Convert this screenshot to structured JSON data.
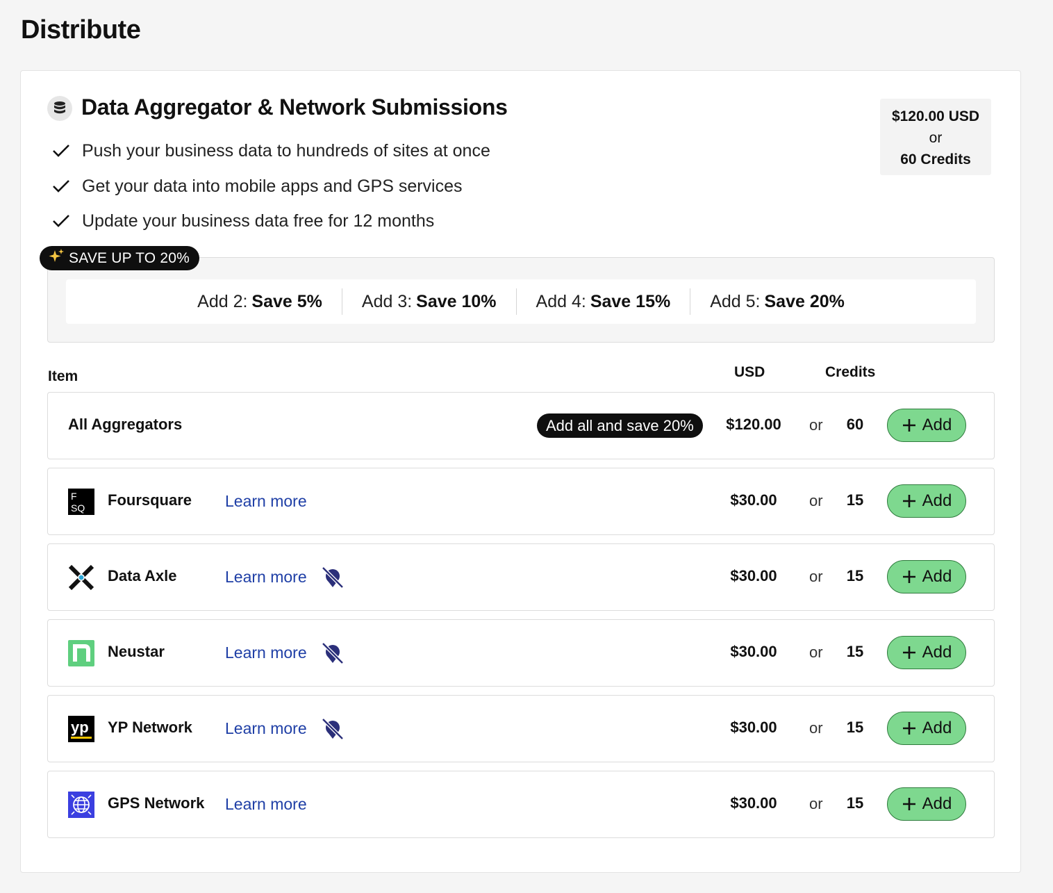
{
  "page": {
    "title": "Distribute"
  },
  "section": {
    "title": "Data Aggregator & Network Submissions",
    "price": {
      "usd": "$120.00 USD",
      "or": "or",
      "credits": "60 Credits"
    },
    "features": [
      "Push your business data to hundreds of sites at once",
      "Get your data into mobile apps and GPS services",
      "Update your business data free for 12 months"
    ]
  },
  "savings": {
    "badge": "SAVE UP TO 20%",
    "tiers": [
      {
        "label": "Add 2:",
        "value": "Save 5%"
      },
      {
        "label": "Add 3:",
        "value": "Save 10%"
      },
      {
        "label": "Add 4:",
        "value": "Save 15%"
      },
      {
        "label": "Add 5:",
        "value": "Save 20%"
      }
    ]
  },
  "table": {
    "headers": {
      "item": "Item",
      "usd": "USD",
      "credits": "Credits"
    },
    "all": {
      "name": "All Aggregators",
      "pill": "Add all and save 20%",
      "usd": "$120.00",
      "or": "or",
      "credits": "60",
      "add": "Add"
    },
    "rows": [
      {
        "name": "Foursquare",
        "learn": "Learn more",
        "usd": "$30.00",
        "or": "or",
        "credits": "15",
        "add": "Add",
        "logo": "foursquare-logo",
        "logo_text": "F SQ"
      },
      {
        "name": "Data Axle",
        "learn": "Learn more",
        "usd": "$30.00",
        "or": "or",
        "credits": "15",
        "add": "Add",
        "logo": "data-axle-logo"
      },
      {
        "name": "Neustar",
        "learn": "Learn more",
        "usd": "$30.00",
        "or": "or",
        "credits": "15",
        "add": "Add",
        "logo": "neustar-logo"
      },
      {
        "name": "YP Network",
        "learn": "Learn more",
        "usd": "$30.00",
        "or": "or",
        "credits": "15",
        "add": "Add",
        "logo": "yp-logo",
        "logo_text": "yp"
      },
      {
        "name": "GPS Network",
        "learn": "Learn more",
        "usd": "$30.00",
        "or": "or",
        "credits": "15",
        "add": "Add",
        "logo": "gps-globe-logo"
      }
    ]
  },
  "colors": {
    "accent_green": "#7ed88f",
    "link_blue": "#1f3fa6",
    "dark": "#0f0f0f",
    "neustar_green": "#5fcf7f",
    "gps_blue": "#3b3fe0"
  }
}
